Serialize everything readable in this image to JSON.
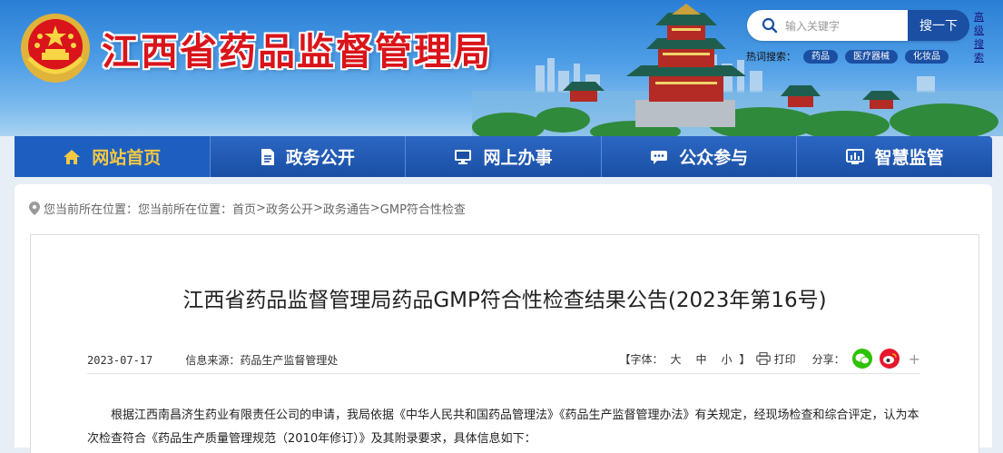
{
  "header": {
    "site_title": "江西省药品监督管理局",
    "search_placeholder": "输入关键字",
    "search_button": "搜一下",
    "advanced_search": "高级搜索",
    "hot_label": "热词搜索：",
    "hot_tags": [
      "药品",
      "医疗器械",
      "化妆品"
    ]
  },
  "nav": {
    "items": [
      {
        "label": "网站首页",
        "icon": "home-icon"
      },
      {
        "label": "政务公开",
        "icon": "document-icon"
      },
      {
        "label": "网上办事",
        "icon": "monitor-icon"
      },
      {
        "label": "公众参与",
        "icon": "chat-icon"
      },
      {
        "label": "智慧监管",
        "icon": "dashboard-icon"
      }
    ],
    "active_index": 0
  },
  "breadcrumb": {
    "prefix": "您当前所在位置：您当前所在位置：",
    "items": [
      "首页",
      "政务公开",
      "政务通告",
      "GMP符合性检查"
    ],
    "separator": ">"
  },
  "article": {
    "title": "江西省药品监督管理局药品GMP符合性检查结果公告(2023年第16号)",
    "date": "2023-07-17",
    "source_label": "信息来源：",
    "source": "药品生产监督管理处",
    "font_label": "【字体：",
    "font_large": "大",
    "font_medium": "中",
    "font_small": "小",
    "font_close": "】",
    "print_label": "打印",
    "share_label": "分享：",
    "body": "根据江西南昌济生药业有限责任公司的申请，我局依据《中华人民共和国药品管理法》《药品生产监督管理办法》有关规定，经现场检查和综合评定，认为本次检查符合《药品生产质量管理规范（2010年修订）》及其附录要求，具体信息如下："
  },
  "colors": {
    "title_red": "#d9141a",
    "nav_blue": "#1a4fa3",
    "nav_active_text": "#f5c842",
    "wechat_green": "#2dc100",
    "weibo_red": "#e6162d"
  }
}
